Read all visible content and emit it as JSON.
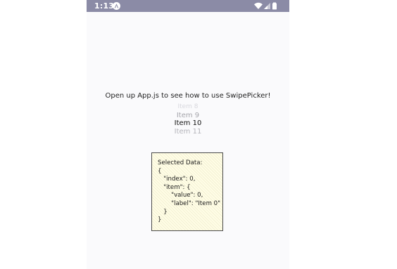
{
  "status_bar": {
    "time": "1:13",
    "background_color": "#8b8ba6",
    "icons": [
      "app-notification-icon",
      "wifi-icon",
      "cellular-signal-icon",
      "battery-icon"
    ]
  },
  "intro_text": "Open up App.js to see how to use SwipePicker!",
  "picker": {
    "items": [
      "Item 8",
      "Item 9",
      "Item 10",
      "Item 11"
    ],
    "selected_item": "Item 10"
  },
  "selected_data": {
    "header": "Selected Data:",
    "lines": [
      "{",
      "   \"index\": 0,",
      "   \"item\": {",
      "       \"value\": 0,",
      "       \"label\": \"Item 0\"",
      "   }",
      "}"
    ]
  }
}
